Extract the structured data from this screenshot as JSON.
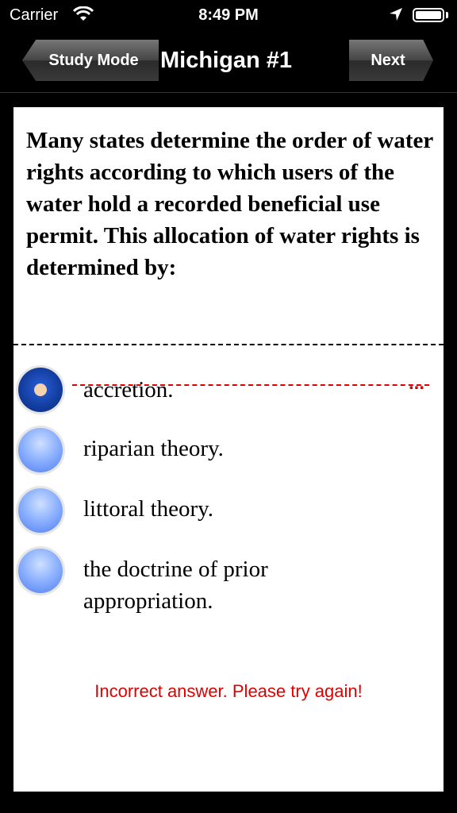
{
  "status_bar": {
    "carrier": "Carrier",
    "time": "8:49 PM"
  },
  "nav": {
    "back_label": "Study Mode",
    "title": "Michigan #1",
    "next_label": "Next"
  },
  "question": "Many states determine the order of water rights according to which users of the water hold a recorded beneficial use permit. This allocation of water rights is determined by:",
  "options": [
    {
      "label": "accretion.",
      "selected": true,
      "crossed_out": true
    },
    {
      "label": "riparian theory.",
      "selected": false
    },
    {
      "label": "littoral theory.",
      "selected": false
    },
    {
      "label": "the doctrine of prior appropriation.",
      "selected": false
    }
  ],
  "truncation_marker": "...",
  "feedback": "Incorrect answer. Please try again!",
  "colors": {
    "error": "#e00000",
    "radio_blue": "#8fb3ff"
  }
}
